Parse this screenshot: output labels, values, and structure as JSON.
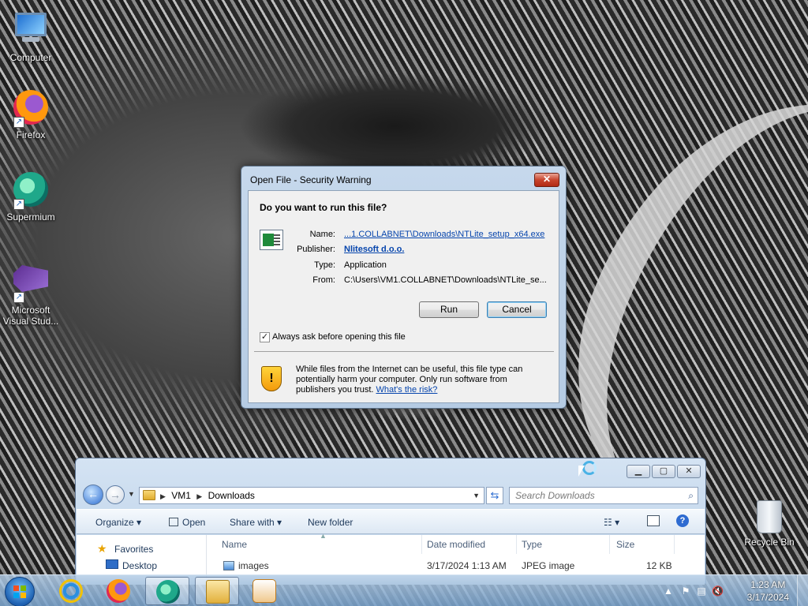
{
  "desktop": {
    "icons": [
      {
        "label": "Computer",
        "icon": "computer-icon"
      },
      {
        "label": "Firefox",
        "icon": "firefox-icon"
      },
      {
        "label": "Supermium",
        "icon": "supermium-icon"
      },
      {
        "label": "Microsoft Visual Stud...",
        "icon": "visual-studio-icon"
      },
      {
        "label": "Recycle Bin",
        "icon": "recycle-bin-icon"
      }
    ]
  },
  "dialog": {
    "title": "Open File - Security Warning",
    "close_label": "✕",
    "question": "Do you want to run this file?",
    "name_label": "Name:",
    "name_value": "...1.COLLABNET\\Downloads\\NTLite_setup_x64.exe",
    "publisher_label": "Publisher:",
    "publisher_value": "Nlitesoft d.o.o.",
    "type_label": "Type:",
    "type_value": "Application",
    "from_label": "From:",
    "from_value": "C:\\Users\\VM1.COLLABNET\\Downloads\\NTLite_se...",
    "run_label": "Run",
    "cancel_label": "Cancel",
    "checkbox_label": "Always ask before opening this file",
    "checkbox_checked": true,
    "warning_text": "While files from the Internet can be useful, this file type can potentially harm your computer. Only run software from publishers you trust.",
    "risk_link": "What's the risk?"
  },
  "explorer": {
    "breadcrumb": [
      "VM1",
      "Downloads"
    ],
    "search_placeholder": "Search Downloads",
    "toolbar": {
      "organize": "Organize ▾",
      "open": "Open",
      "share_with": "Share with ▾",
      "new_folder": "New folder"
    },
    "nav": {
      "favorites": "Favorites",
      "desktop": "Desktop"
    },
    "columns": [
      "Name",
      "Date modified",
      "Type",
      "Size"
    ],
    "rows": [
      {
        "name": "images",
        "date": "3/17/2024 1:13 AM",
        "type": "JPEG image",
        "size": "12 KB"
      }
    ]
  },
  "taskbar": {
    "apps": [
      "internet-explorer",
      "firefox",
      "supermium",
      "file-explorer",
      "media-player"
    ],
    "clock_time": "1:23 AM",
    "clock_date": "3/17/2024"
  }
}
